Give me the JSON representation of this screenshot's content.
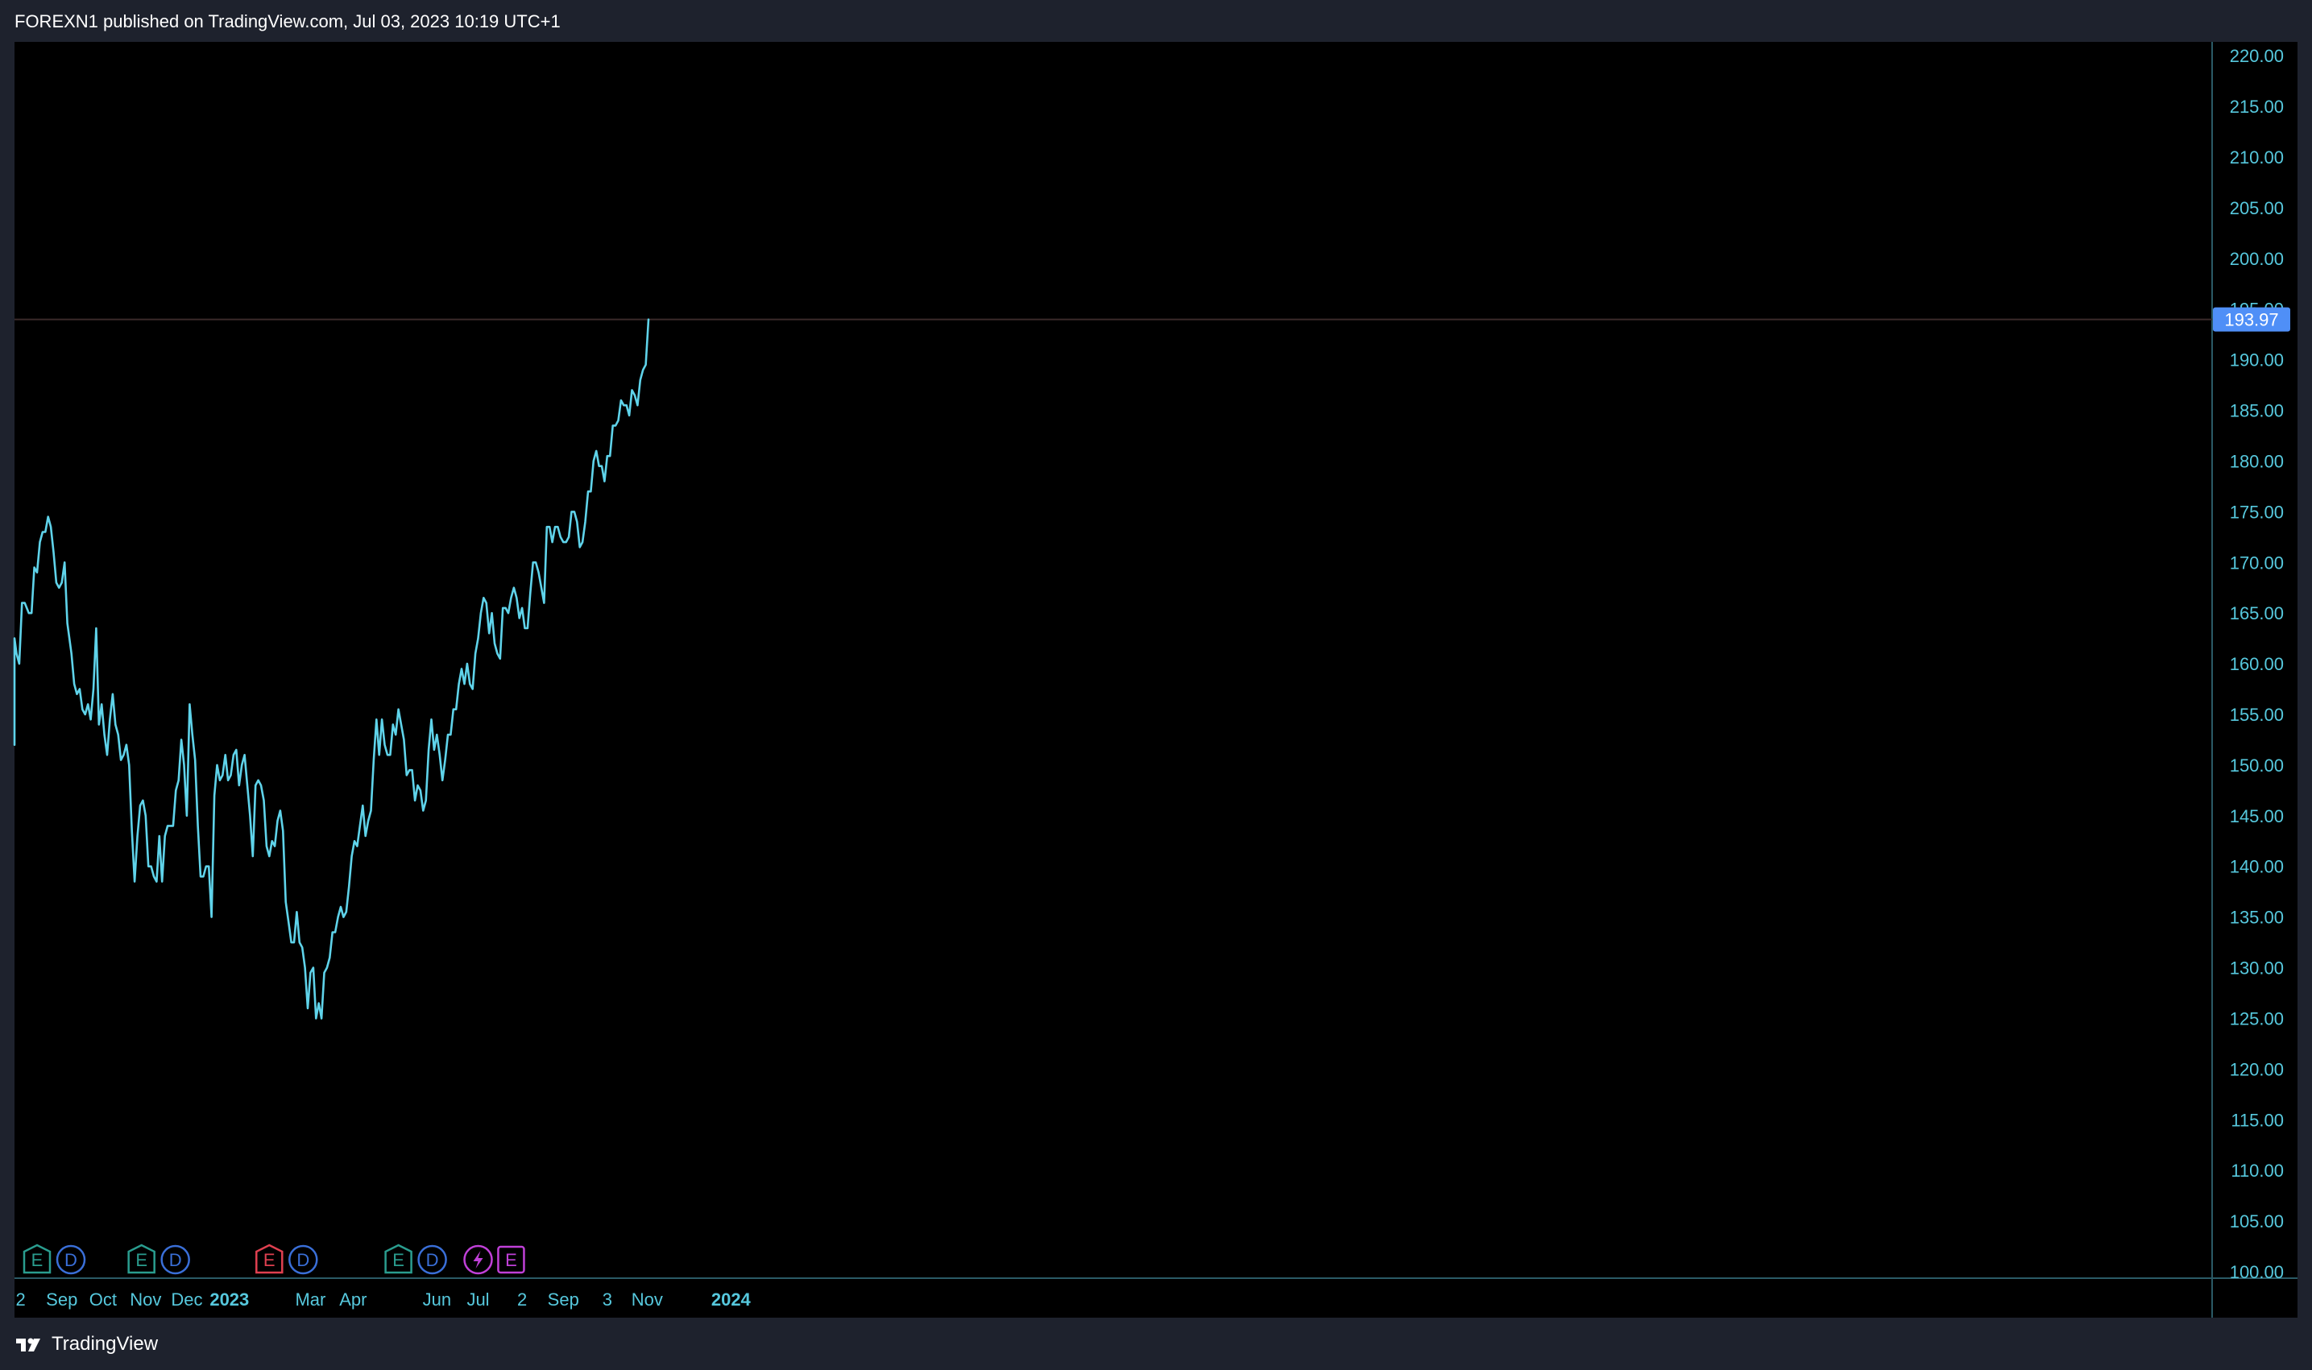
{
  "header": {
    "text": "FOREXN1 published on TradingView.com, Jul 03, 2023 10:19 UTC+1"
  },
  "footer": {
    "brand": "TradingView"
  },
  "theme": {
    "background": "#000000",
    "frame": "#1e222d",
    "line_color": "#5fd3ea",
    "axis_text_color": "#56c8dd",
    "price_badge_bg": "#4f8ff7",
    "price_line_color": "#3b2a2a",
    "border_color": "#2a5a66"
  },
  "chart_data": {
    "type": "line",
    "title": "",
    "xlabel": "",
    "ylabel": "",
    "ylim": [
      100,
      222
    ],
    "y_ticks": [
      "100.00",
      "105.00",
      "110.00",
      "115.00",
      "120.00",
      "125.00",
      "130.00",
      "135.00",
      "140.00",
      "145.00",
      "150.00",
      "155.00",
      "160.00",
      "165.00",
      "170.00",
      "175.00",
      "180.00",
      "185.00",
      "190.00",
      "195.00",
      "200.00",
      "205.00",
      "210.00",
      "215.00",
      "220.00"
    ],
    "x_tick_labels": [
      {
        "label": "2",
        "date": "2022-08-02",
        "bold": false
      },
      {
        "label": "Sep",
        "date": "2022-09-01",
        "bold": false
      },
      {
        "label": "Oct",
        "date": "2022-10-01",
        "bold": false
      },
      {
        "label": "Nov",
        "date": "2022-11-01",
        "bold": false
      },
      {
        "label": "Dec",
        "date": "2022-12-01",
        "bold": false
      },
      {
        "label": "2023",
        "date": "2023-01-01",
        "bold": true
      },
      {
        "label": "Mar",
        "date": "2023-03-01",
        "bold": false
      },
      {
        "label": "Apr",
        "date": "2023-04-01",
        "bold": false
      },
      {
        "label": "Jun",
        "date": "2023-06-01",
        "bold": false
      },
      {
        "label": "Jul",
        "date": "2023-07-01",
        "bold": false
      },
      {
        "label": "2",
        "date": "2023-08-02",
        "bold": false
      },
      {
        "label": "Sep",
        "date": "2023-09-01",
        "bold": false
      },
      {
        "label": "3",
        "date": "2023-10-03",
        "bold": false
      },
      {
        "label": "Nov",
        "date": "2023-11-01",
        "bold": false
      },
      {
        "label": "2024",
        "date": "2024-01-01",
        "bold": true
      }
    ],
    "last_price": "193.97",
    "series": [
      {
        "points": [
          [
            "2022-07-20",
            154.0
          ],
          [
            "2022-07-22",
            152.0
          ],
          [
            "2022-07-24",
            157.0
          ],
          [
            "2022-07-26",
            157.5
          ],
          [
            "2022-07-28",
            162.5
          ],
          [
            "2022-07-30",
            161.0
          ],
          [
            "2022-08-01",
            160.0
          ],
          [
            "2022-08-03",
            166.0
          ],
          [
            "2022-08-05",
            166.0
          ],
          [
            "2022-08-08",
            165.0
          ],
          [
            "2022-08-10",
            165.0
          ],
          [
            "2022-08-12",
            169.5
          ],
          [
            "2022-08-14",
            169.0
          ],
          [
            "2022-08-16",
            172.0
          ],
          [
            "2022-08-18",
            173.0
          ],
          [
            "2022-08-20",
            173.0
          ],
          [
            "2022-08-22",
            174.5
          ],
          [
            "2022-08-24",
            173.5
          ],
          [
            "2022-08-26",
            171.0
          ],
          [
            "2022-08-28",
            168.0
          ],
          [
            "2022-08-30",
            167.5
          ],
          [
            "2022-09-01",
            168.0
          ],
          [
            "2022-09-03",
            170.0
          ],
          [
            "2022-09-05",
            164.0
          ],
          [
            "2022-09-08",
            161.0
          ],
          [
            "2022-09-10",
            158.0
          ],
          [
            "2022-09-12",
            157.0
          ],
          [
            "2022-09-14",
            157.5
          ],
          [
            "2022-09-16",
            155.5
          ],
          [
            "2022-09-18",
            155.0
          ],
          [
            "2022-09-20",
            156.0
          ],
          [
            "2022-09-22",
            154.5
          ],
          [
            "2022-09-24",
            157.5
          ],
          [
            "2022-09-26",
            163.5
          ],
          [
            "2022-09-28",
            154.0
          ],
          [
            "2022-09-30",
            156.0
          ],
          [
            "2022-10-02",
            153.0
          ],
          [
            "2022-10-04",
            151.0
          ],
          [
            "2022-10-06",
            154.5
          ],
          [
            "2022-10-08",
            157.0
          ],
          [
            "2022-10-10",
            154.0
          ],
          [
            "2022-10-12",
            153.0
          ],
          [
            "2022-10-14",
            150.5
          ],
          [
            "2022-10-16",
            151.0
          ],
          [
            "2022-10-18",
            152.0
          ],
          [
            "2022-10-20",
            150.0
          ],
          [
            "2022-10-22",
            143.5
          ],
          [
            "2022-10-24",
            138.5
          ],
          [
            "2022-10-26",
            143.0
          ],
          [
            "2022-10-28",
            146.0
          ],
          [
            "2022-10-30",
            146.5
          ],
          [
            "2022-11-01",
            145.0
          ],
          [
            "2022-11-03",
            140.0
          ],
          [
            "2022-11-05",
            140.0
          ],
          [
            "2022-11-07",
            139.0
          ],
          [
            "2022-11-09",
            138.5
          ],
          [
            "2022-11-11",
            143.0
          ],
          [
            "2022-11-13",
            138.5
          ],
          [
            "2022-11-15",
            143.0
          ],
          [
            "2022-11-17",
            144.0
          ],
          [
            "2022-11-19",
            144.0
          ],
          [
            "2022-11-21",
            144.0
          ],
          [
            "2022-11-23",
            147.5
          ],
          [
            "2022-11-25",
            148.5
          ],
          [
            "2022-11-27",
            152.5
          ],
          [
            "2022-11-29",
            150.0
          ],
          [
            "2022-12-01",
            145.0
          ],
          [
            "2022-12-03",
            156.0
          ],
          [
            "2022-12-05",
            153.0
          ],
          [
            "2022-12-07",
            150.5
          ],
          [
            "2022-12-09",
            144.0
          ],
          [
            "2022-12-11",
            139.0
          ],
          [
            "2022-12-13",
            139.0
          ],
          [
            "2022-12-15",
            140.0
          ],
          [
            "2022-12-17",
            140.0
          ],
          [
            "2022-12-19",
            135.0
          ],
          [
            "2022-12-21",
            147.0
          ],
          [
            "2022-12-23",
            150.0
          ],
          [
            "2022-12-25",
            148.5
          ],
          [
            "2022-12-27",
            149.0
          ],
          [
            "2022-12-29",
            151.0
          ],
          [
            "2022-12-31",
            148.5
          ],
          [
            "2023-01-02",
            149.0
          ],
          [
            "2023-01-04",
            151.0
          ],
          [
            "2023-01-06",
            151.5
          ],
          [
            "2023-01-08",
            148.0
          ],
          [
            "2023-01-10",
            150.0
          ],
          [
            "2023-01-12",
            151.0
          ],
          [
            "2023-01-14",
            148.0
          ],
          [
            "2023-01-16",
            145.0
          ],
          [
            "2023-01-18",
            141.0
          ],
          [
            "2023-01-20",
            148.0
          ],
          [
            "2023-01-22",
            148.5
          ],
          [
            "2023-01-24",
            148.0
          ],
          [
            "2023-01-26",
            146.5
          ],
          [
            "2023-01-28",
            142.0
          ],
          [
            "2023-01-30",
            141.0
          ],
          [
            "2023-02-01",
            142.5
          ],
          [
            "2023-02-03",
            142.0
          ],
          [
            "2023-02-05",
            144.5
          ],
          [
            "2023-02-07",
            145.5
          ],
          [
            "2023-02-09",
            143.5
          ],
          [
            "2023-02-11",
            136.5
          ],
          [
            "2023-02-13",
            134.5
          ],
          [
            "2023-02-15",
            132.5
          ],
          [
            "2023-02-17",
            132.5
          ],
          [
            "2023-02-19",
            135.5
          ],
          [
            "2023-02-21",
            132.5
          ],
          [
            "2023-02-23",
            132.0
          ],
          [
            "2023-02-25",
            130.0
          ],
          [
            "2023-02-27",
            126.0
          ],
          [
            "2023-03-01",
            129.5
          ],
          [
            "2023-03-03",
            130.0
          ],
          [
            "2023-03-05",
            125.0
          ],
          [
            "2023-03-07",
            126.5
          ],
          [
            "2023-03-09",
            125.0
          ],
          [
            "2023-03-11",
            129.5
          ],
          [
            "2023-03-13",
            130.0
          ],
          [
            "2023-03-15",
            131.0
          ],
          [
            "2023-03-17",
            133.5
          ],
          [
            "2023-03-19",
            133.5
          ],
          [
            "2023-03-21",
            135.0
          ],
          [
            "2023-03-23",
            136.0
          ],
          [
            "2023-03-25",
            135.0
          ],
          [
            "2023-03-27",
            135.5
          ],
          [
            "2023-03-29",
            138.0
          ],
          [
            "2023-03-31",
            141.0
          ],
          [
            "2023-04-02",
            142.5
          ],
          [
            "2023-04-04",
            142.0
          ],
          [
            "2023-04-06",
            144.0
          ],
          [
            "2023-04-08",
            146.0
          ],
          [
            "2023-04-10",
            143.0
          ],
          [
            "2023-04-12",
            144.5
          ],
          [
            "2023-04-14",
            145.5
          ],
          [
            "2023-04-16",
            150.5
          ],
          [
            "2023-04-18",
            154.5
          ],
          [
            "2023-04-20",
            151.0
          ],
          [
            "2023-04-22",
            154.5
          ],
          [
            "2023-04-24",
            152.0
          ],
          [
            "2023-04-26",
            151.0
          ],
          [
            "2023-04-28",
            151.0
          ],
          [
            "2023-04-30",
            154.0
          ],
          [
            "2023-05-02",
            153.0
          ],
          [
            "2023-05-04",
            155.5
          ],
          [
            "2023-05-06",
            154.0
          ],
          [
            "2023-05-08",
            152.5
          ],
          [
            "2023-05-10",
            149.0
          ],
          [
            "2023-05-12",
            149.5
          ],
          [
            "2023-05-14",
            149.5
          ],
          [
            "2023-05-16",
            146.5
          ],
          [
            "2023-05-18",
            148.0
          ],
          [
            "2023-05-20",
            147.5
          ],
          [
            "2023-05-22",
            145.5
          ],
          [
            "2023-05-24",
            146.5
          ],
          [
            "2023-05-26",
            151.5
          ],
          [
            "2023-05-28",
            154.5
          ],
          [
            "2023-05-30",
            151.5
          ],
          [
            "2023-06-01",
            153.0
          ],
          [
            "2023-06-03",
            151.0
          ],
          [
            "2023-06-05",
            148.5
          ],
          [
            "2023-06-07",
            150.5
          ],
          [
            "2023-06-09",
            153.0
          ],
          [
            "2023-06-11",
            153.0
          ],
          [
            "2023-06-13",
            155.5
          ],
          [
            "2023-06-15",
            155.5
          ],
          [
            "2023-06-17",
            158.0
          ],
          [
            "2023-06-19",
            159.5
          ],
          [
            "2023-06-21",
            158.0
          ],
          [
            "2023-06-23",
            160.0
          ],
          [
            "2023-06-25",
            158.0
          ],
          [
            "2023-06-27",
            157.5
          ],
          [
            "2023-06-29",
            161.0
          ],
          [
            "2023-07-01",
            162.5
          ],
          [
            "2023-07-03",
            165.0
          ],
          [
            "2023-07-05",
            166.5
          ],
          [
            "2023-07-07",
            166.0
          ],
          [
            "2023-07-09",
            163.0
          ],
          [
            "2023-07-11",
            165.0
          ],
          [
            "2023-07-13",
            162.0
          ],
          [
            "2023-07-15",
            161.0
          ],
          [
            "2023-07-17",
            160.5
          ],
          [
            "2023-07-19",
            165.5
          ],
          [
            "2023-07-21",
            165.5
          ],
          [
            "2023-07-23",
            165.0
          ],
          [
            "2023-07-25",
            166.5
          ],
          [
            "2023-07-27",
            167.5
          ],
          [
            "2023-07-29",
            166.5
          ],
          [
            "2023-07-31",
            164.5
          ],
          [
            "2023-08-02",
            165.5
          ],
          [
            "2023-08-04",
            163.5
          ],
          [
            "2023-08-06",
            163.5
          ],
          [
            "2023-08-08",
            167.0
          ],
          [
            "2023-08-10",
            170.0
          ],
          [
            "2023-08-12",
            170.0
          ],
          [
            "2023-08-14",
            169.0
          ],
          [
            "2023-08-16",
            167.5
          ],
          [
            "2023-08-18",
            166.0
          ],
          [
            "2023-08-20",
            173.5
          ],
          [
            "2023-08-22",
            173.5
          ],
          [
            "2023-08-24",
            172.0
          ],
          [
            "2023-08-26",
            173.5
          ],
          [
            "2023-08-28",
            173.5
          ],
          [
            "2023-08-30",
            172.5
          ],
          [
            "2023-09-01",
            172.0
          ],
          [
            "2023-09-03",
            172.0
          ],
          [
            "2023-09-05",
            172.5
          ],
          [
            "2023-09-07",
            175.0
          ],
          [
            "2023-09-09",
            175.0
          ],
          [
            "2023-09-11",
            174.0
          ],
          [
            "2023-09-13",
            171.5
          ],
          [
            "2023-09-15",
            172.0
          ],
          [
            "2023-09-17",
            174.0
          ],
          [
            "2023-09-19",
            177.0
          ],
          [
            "2023-09-21",
            177.0
          ],
          [
            "2023-09-23",
            180.0
          ],
          [
            "2023-09-25",
            181.0
          ],
          [
            "2023-09-27",
            179.5
          ],
          [
            "2023-09-29",
            179.5
          ],
          [
            "2023-10-01",
            178.0
          ],
          [
            "2023-10-03",
            180.5
          ],
          [
            "2023-10-05",
            180.5
          ],
          [
            "2023-10-07",
            183.5
          ],
          [
            "2023-10-09",
            183.5
          ],
          [
            "2023-10-11",
            184.0
          ],
          [
            "2023-10-13",
            186.0
          ],
          [
            "2023-10-15",
            185.5
          ],
          [
            "2023-10-17",
            185.5
          ],
          [
            "2023-10-19",
            184.5
          ],
          [
            "2023-10-21",
            187.0
          ],
          [
            "2023-10-23",
            186.5
          ],
          [
            "2023-10-25",
            185.5
          ],
          [
            "2023-10-27",
            188.0
          ],
          [
            "2023-10-29",
            189.0
          ],
          [
            "2023-10-31",
            189.5
          ],
          [
            "2023-11-02",
            193.97
          ]
        ]
      }
    ],
    "event_markers": [
      {
        "date": "2022-07-26",
        "icons": [
          "E",
          "D"
        ],
        "e_color": "#2a9d8f"
      },
      {
        "date": "2022-10-29",
        "icons": [
          "E",
          "D"
        ],
        "e_color": "#2a9d8f"
      },
      {
        "date": "2023-01-30",
        "icons": [
          "E",
          "D"
        ],
        "e_color": "#e04050"
      },
      {
        "date": "2023-05-04",
        "icons": [
          "E",
          "D"
        ],
        "e_color": "#2a9d8f"
      },
      {
        "date": "2023-07-01",
        "icons": [
          "bolt"
        ],
        "e_color": "#c040d8"
      },
      {
        "date": "2023-07-25",
        "icons": [
          "E"
        ],
        "e_color": "#c040d8"
      }
    ]
  }
}
